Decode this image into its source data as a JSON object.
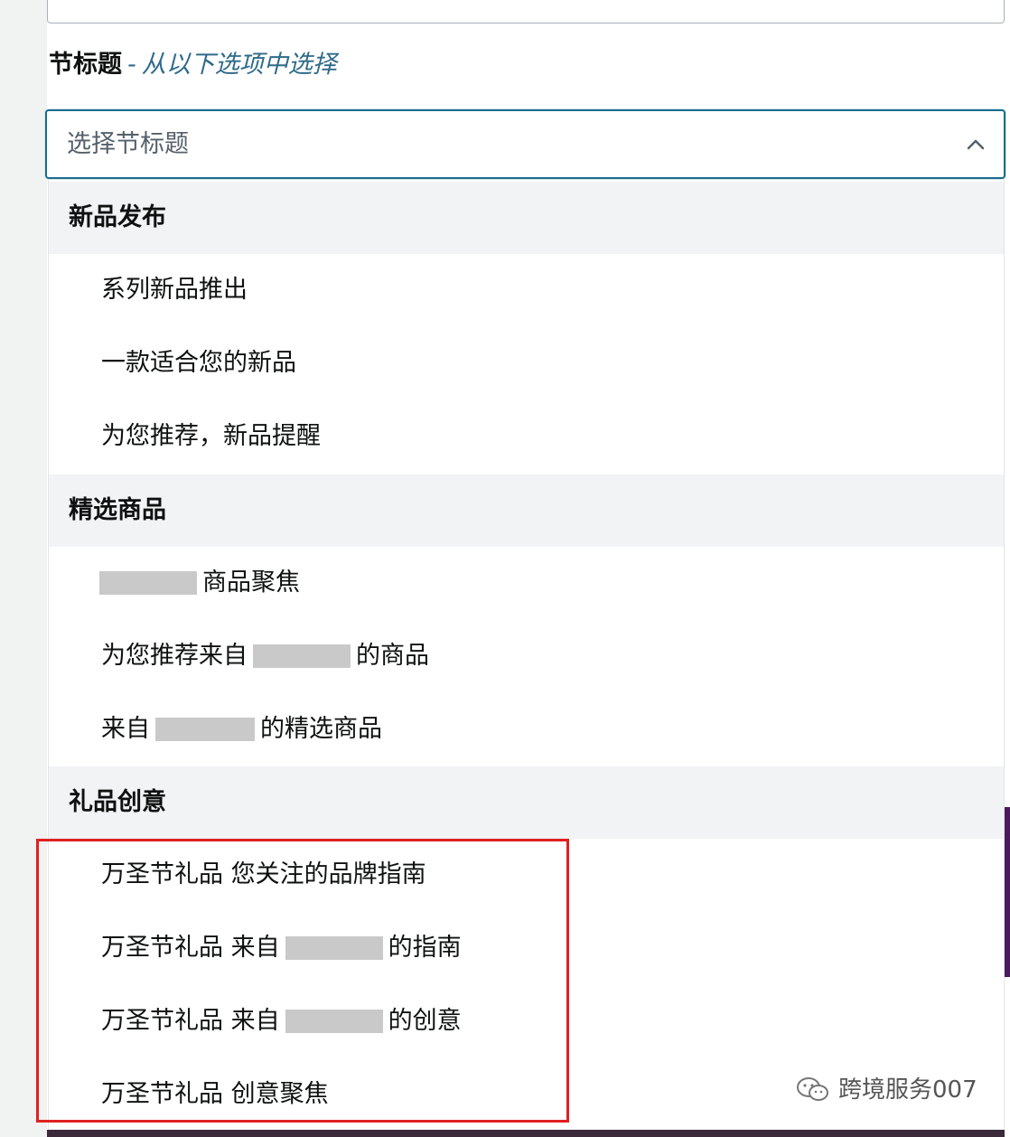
{
  "section": {
    "title": "节标题",
    "separator": "-",
    "hint": "从以下选项中选择"
  },
  "select": {
    "placeholder": "选择节标题",
    "chevron_icon": "chevron-up-icon"
  },
  "groups": [
    {
      "header": "新品发布",
      "options": [
        {
          "parts": [
            "系列新品推出"
          ]
        },
        {
          "parts": [
            "一款适合您的新品"
          ]
        },
        {
          "parts": [
            "为您推荐，新品提醒"
          ]
        }
      ]
    },
    {
      "header": "精选商品",
      "options": [
        {
          "parts": [
            "",
            "商品聚焦"
          ]
        },
        {
          "parts": [
            "为您推荐来自",
            "的商品"
          ]
        },
        {
          "parts": [
            "来自",
            "的精选商品"
          ]
        }
      ]
    },
    {
      "header": "礼品创意",
      "options": [
        {
          "parts": [
            "万圣节礼品 您关注的品牌指南"
          ]
        },
        {
          "parts": [
            "万圣节礼品 来自",
            "的指南"
          ]
        },
        {
          "parts": [
            "万圣节礼品 来自",
            "的创意"
          ]
        },
        {
          "parts": [
            "万圣节礼品 创意聚焦"
          ]
        }
      ]
    }
  ],
  "watermark": {
    "text": "跨境服务007",
    "icon": "wechat-icon"
  },
  "colors": {
    "focus_border": "#1a6d88",
    "hint_text": "#2f6b8a",
    "group_header_bg": "#f1f3f4",
    "highlight_red": "#e02020"
  }
}
